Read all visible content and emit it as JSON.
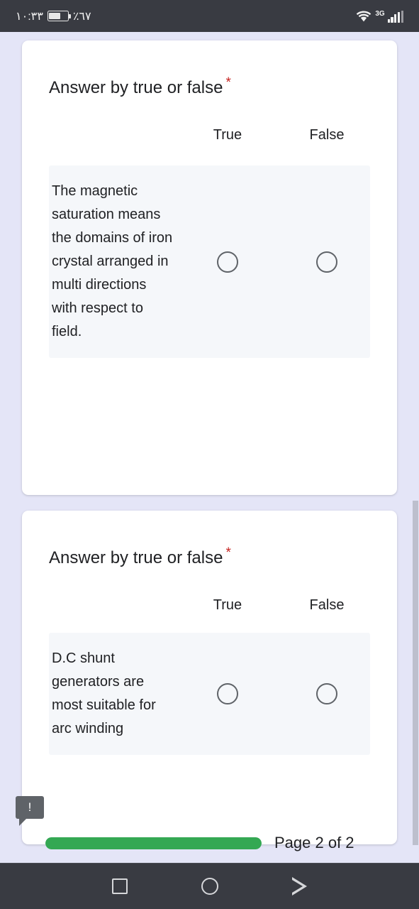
{
  "status_bar": {
    "time": "١٠:٣٣",
    "battery_percent": "٪٦٧",
    "battery_icon": "battery-icon",
    "wifi_icon": "wifi-icon",
    "network_type": "3G",
    "signal_icon": "signal-bars-icon"
  },
  "questions": [
    {
      "title": "Answer by true or false",
      "required_marker": "*",
      "columns": [
        "True",
        "False"
      ],
      "statement": "The magnetic saturation means the domains of iron crystal arranged in multi directions with respect to field.",
      "selected": null
    },
    {
      "title": "Answer by true or false",
      "required_marker": "*",
      "columns": [
        "True",
        "False"
      ],
      "statement": "D.C shunt generators are most suitable for arc winding",
      "selected": null
    }
  ],
  "footer": {
    "tooltip_badge": "!",
    "progress_percent": 100,
    "progress_color": "#34a853",
    "page_label": "Page 2 of 2"
  },
  "nav_bar": {
    "recents_icon": "square-icon",
    "home_icon": "circle-icon",
    "back_icon": "triangle-right-icon"
  }
}
